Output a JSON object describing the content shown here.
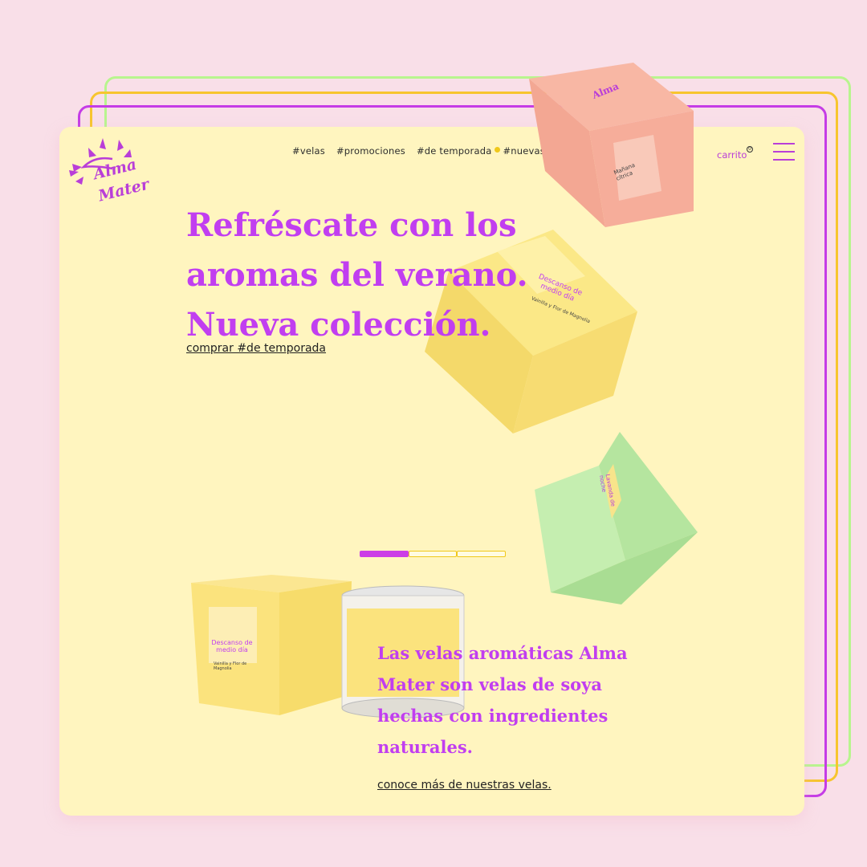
{
  "brand": {
    "logo_line1": "Alma",
    "logo_line2": "Mater"
  },
  "nav": {
    "items": [
      "#velas",
      "#promociones",
      "#de temporada",
      "#nuevas"
    ]
  },
  "header": {
    "cart_label": "carrito",
    "cart_count": "0"
  },
  "hero": {
    "title_line1": "Refréscate con los",
    "title_line2": "aromas del verano.",
    "title_line3": "Nueva colección.",
    "cta": "comprar #de temporada"
  },
  "about": {
    "text": "Las velas aromáticas Alma Mater son velas de soya hechas con ingredientes naturales.",
    "cta": "conoce más de nuestras velas."
  },
  "products": {
    "pink_box_name": "Mañana cítrica",
    "yellow_box_name": "Descanso de medio día",
    "yellow_box_scent": "Vainilla y Flor de Magnolia",
    "green_box_name": "Lavanda de noche",
    "pack_box_name": "Descanso de medio día",
    "pack_box_scent": "Vainilla y Flor de Magnolia"
  },
  "carousel": {
    "active_index": 0,
    "count": 3
  },
  "colors": {
    "accent": "#c13ef0",
    "page_bg": "#fff5bf",
    "outer_bg": "#f9dfe8",
    "frame_green": "#b8f58e",
    "frame_yellow": "#f7c52f",
    "frame_purple": "#c53ce6"
  }
}
